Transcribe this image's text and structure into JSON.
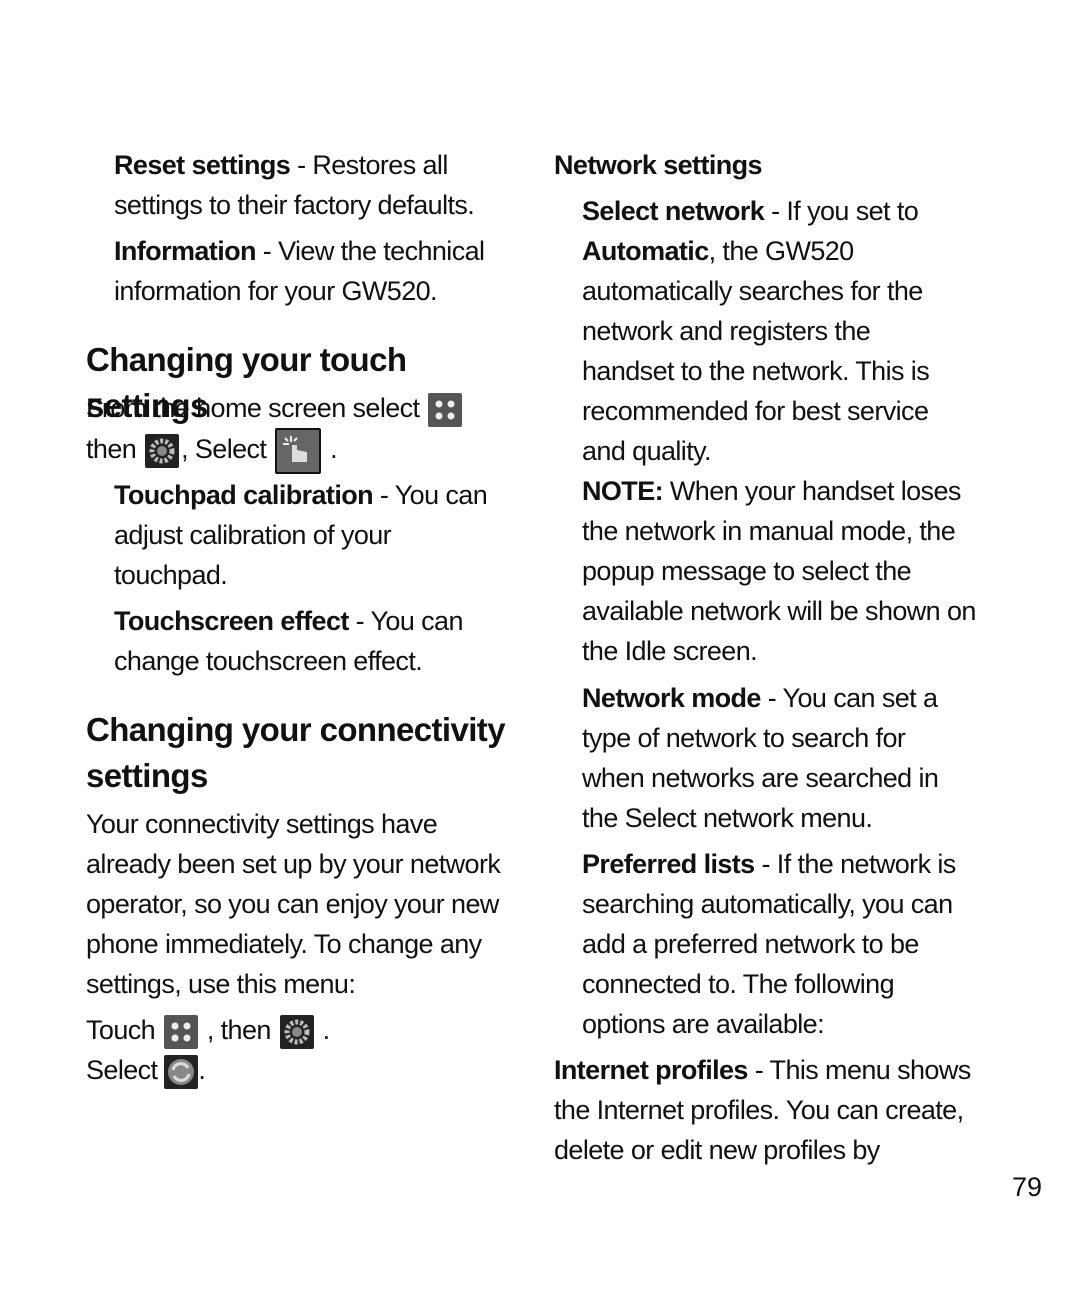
{
  "left": {
    "reset": {
      "term": "Reset settings",
      "desc": " - Restores all settings to their factory defaults."
    },
    "information": {
      "term": "Information",
      "desc": " - View the technical information for your GW520."
    },
    "touch_heading": "Changing your touch settings",
    "touch_intro": {
      "part1": "From the home screen select ",
      "part2": "then ",
      "part3": ", Select ",
      "part4": " ."
    },
    "touchpad": {
      "term": "Touchpad calibration",
      "desc": " - You can adjust calibration of your touchpad."
    },
    "touchscreen": {
      "term": "Touchscreen effect",
      "desc": "  - You can change touchscreen effect."
    },
    "connectivity_heading": "Changing your connectivity settings",
    "connectivity_body": "Your connectivity settings have already been set up by your network operator, so you can enjoy your new phone immediately. To change any settings, use this menu:",
    "touch_line": {
      "part1": "Touch ",
      "part2": " , then ",
      "part3": " .",
      "part4": "Select ",
      "part5": "."
    }
  },
  "right": {
    "network_heading": "Network settings",
    "select_network": {
      "term": "Select network",
      "desc1": " -  If you set to ",
      "bold2": "Automatic",
      "desc2": ", the GW520 automatically searches for the network and registers the handset to the network. This is recommended for best service and quality."
    },
    "note": {
      "term": "NOTE:",
      "desc": " When your handset loses the network in manual mode, the popup message to select the available network will be shown on the Idle screen."
    },
    "network_mode": {
      "term": "Network mode",
      "desc": " - You can set a type of network to search for when networks are searched in the Select network menu."
    },
    "preferred": {
      "term": "Preferred lists",
      "desc": " - If the network is searching automatically, you can add a preferred network to be connected to. The following options are available:"
    },
    "internet": {
      "term": "Internet profiles",
      "desc": " - This menu shows the Internet profiles. You can create, delete or edit new profiles by"
    }
  },
  "page_number": "79",
  "icons": [
    "menu-grid-icon",
    "settings-gear-icon",
    "touch-icon",
    "connectivity-icon"
  ]
}
